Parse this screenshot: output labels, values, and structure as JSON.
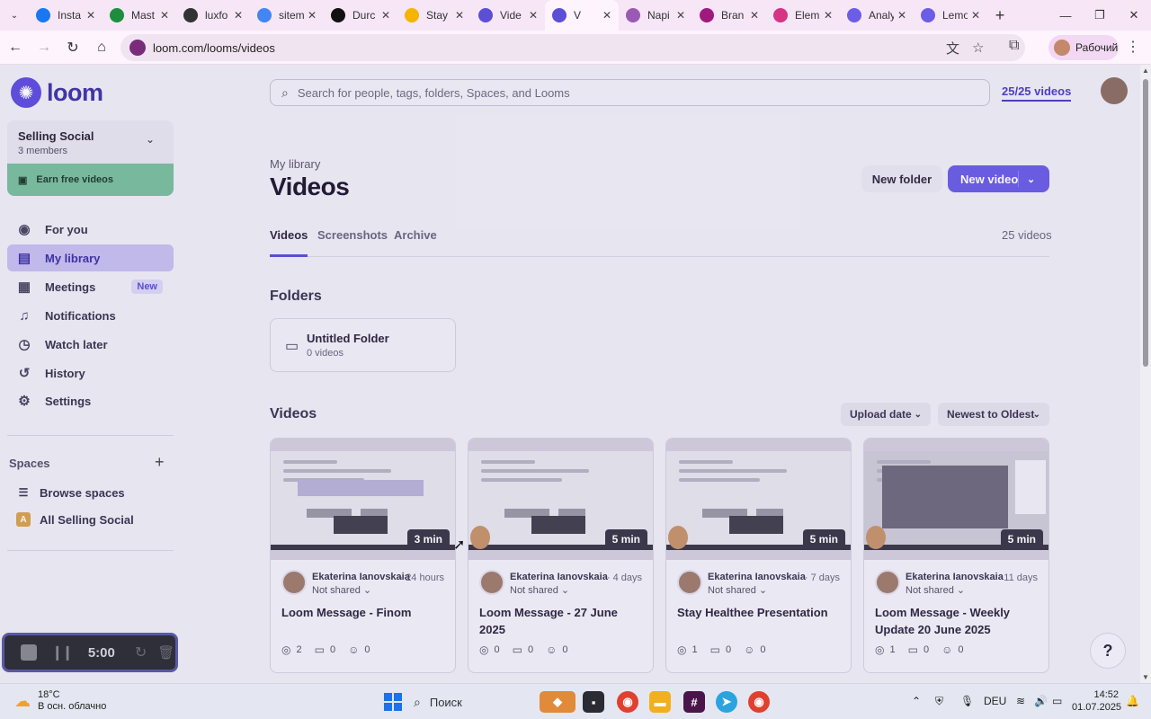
{
  "browser": {
    "tabs": [
      {
        "label": "Insta",
        "color": "#1877f2",
        "active": false
      },
      {
        "label": "Mast",
        "color": "#1e8e3e",
        "active": false
      },
      {
        "label": "luxfo",
        "color": "#333333",
        "active": false
      },
      {
        "label": "sitem",
        "color": "#4285f4",
        "active": false
      },
      {
        "label": "Durc",
        "color": "#111111",
        "active": false
      },
      {
        "label": "Stay",
        "color": "#f4b400",
        "active": false
      },
      {
        "label": "Vide",
        "color": "#5b4fd6",
        "active": false
      },
      {
        "label": "V",
        "color": "#5b4fd6",
        "active": true
      },
      {
        "label": "Napi",
        "color": "#9b59b6",
        "active": false
      },
      {
        "label": "Bran",
        "color": "#a01a7d",
        "active": false
      },
      {
        "label": "Elem",
        "color": "#d63384",
        "active": false
      },
      {
        "label": "Analy",
        "color": "#6b5de6",
        "active": false
      },
      {
        "label": "Lemo",
        "color": "#6b5de6",
        "active": false
      }
    ],
    "url": "loom.com/looms/videos",
    "profile_label": "Рабочий"
  },
  "sidebar": {
    "brand": "loom",
    "workspace_name": "Selling Social",
    "workspace_members": "3 members",
    "earn_label": "Earn free videos",
    "nav": [
      {
        "label": "For you",
        "icon": "person-circle-icon",
        "active": false
      },
      {
        "label": "My library",
        "icon": "library-icon",
        "active": true
      },
      {
        "label": "Meetings",
        "icon": "calendar-icon",
        "active": false,
        "badge": "New"
      },
      {
        "label": "Notifications",
        "icon": "bell-icon",
        "active": false
      },
      {
        "label": "Watch later",
        "icon": "clock-icon",
        "active": false
      },
      {
        "label": "History",
        "icon": "history-icon",
        "active": false
      },
      {
        "label": "Settings",
        "icon": "gear-icon",
        "active": false
      }
    ],
    "spaces_title": "Spaces",
    "spaces": [
      {
        "label": "Browse spaces",
        "icon": "list-icon"
      },
      {
        "label": "All Selling Social",
        "icon": "A"
      }
    ],
    "recorder_time": "5:00"
  },
  "main": {
    "search_placeholder": "Search for people, tags, folders, Spaces, and Looms",
    "usage": "25/25 videos",
    "breadcrumb": "My library",
    "title": "Videos",
    "new_folder_label": "New folder",
    "new_video_label": "New video",
    "tabs": [
      "Videos",
      "Screenshots",
      "Archive"
    ],
    "active_tab": "Videos",
    "video_count": "25 videos",
    "folders_title": "Folders",
    "folder": {
      "name": "Untitled Folder",
      "count": "0 videos"
    },
    "videos_title": "Videos",
    "sort_by": "Upload date",
    "sort_order": "Newest to Oldest",
    "videos": [
      {
        "duration": "3 min",
        "author": "Ekaterina Ianovskaia",
        "shared": "Not shared",
        "age": "· 24 hours",
        "title": "Loom Message - Finom",
        "views": "2",
        "comments": "0",
        "reactions": "0"
      },
      {
        "duration": "5 min",
        "author": "Ekaterina Ianovskaia",
        "shared": "Not shared",
        "age": "· 4 days",
        "title": "Loom Message - 27 June 2025",
        "views": "0",
        "comments": "0",
        "reactions": "0"
      },
      {
        "duration": "5 min",
        "author": "Ekaterina Ianovskaia",
        "shared": "Not shared",
        "age": "· 7 days",
        "title": "Stay Healthee Presentation",
        "views": "1",
        "comments": "0",
        "reactions": "0"
      },
      {
        "duration": "5 min",
        "author": "Ekaterina Ianovskaia",
        "shared": "Not shared",
        "age": "· 11 days",
        "title": "Loom Message - Weekly Update 20 June 2025",
        "views": "1",
        "comments": "0",
        "reactions": "0"
      }
    ],
    "help_label": "?"
  },
  "taskbar": {
    "temperature": "18°C",
    "weather": "В осн. облачно",
    "search_label": "Поиск",
    "language": "DEU",
    "time": "14:52",
    "date": "01.07.2025"
  }
}
